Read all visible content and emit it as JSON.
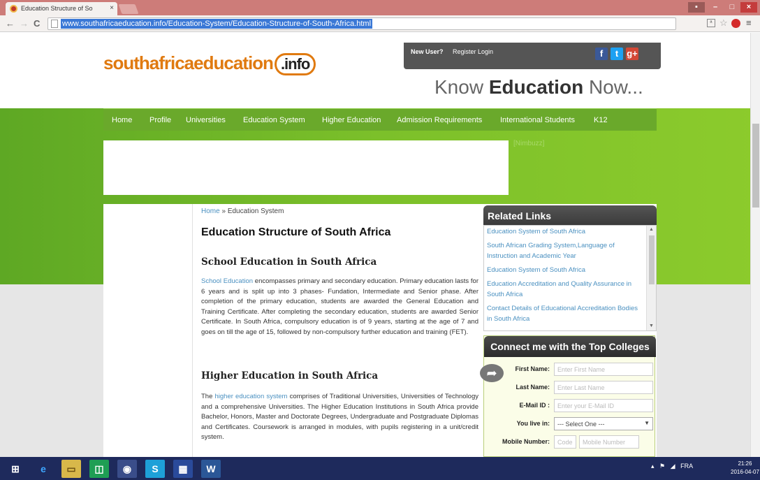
{
  "browser": {
    "tab_title": "Education Structure of So",
    "url": "www.southafricaeducation.info/Education-System/Education-Structure-of-South-Africa.html"
  },
  "header": {
    "logo_text": "southafricaeducation",
    "logo_badge": ".info",
    "new_user": "New User?",
    "register_login": "Register Login",
    "tagline_pre": "Know",
    "tagline_bold": "Education",
    "tagline_post": "Now..."
  },
  "nav": {
    "items": [
      "Home",
      "Profile",
      "Universities",
      "Education System",
      "Higher Education",
      "Admission Requirements",
      "International Students",
      "K12"
    ]
  },
  "ad_label": "[Nimbuzz]",
  "breadcrumb": {
    "home": "Home",
    "sep": "»",
    "current": "Education System"
  },
  "article": {
    "title": "Education Structure of South Africa",
    "sections": [
      {
        "heading": "School Education in South Africa",
        "link": "School Education",
        "text": " encompasses primary and secondary education. Primary education lasts for 6 years and is split up into 3 phases- Fundation, Intermediate and Senior phase. After completion of the primary education, students are awarded the General Education and Training Certificate. After completing the secondary education, students are awarded Senior Certificate. In South Africa, compulsory education is of 9 years, starting at the age of 7 and goes on till the age of 15, followed by non-compulsory further education and training (FET)."
      },
      {
        "heading": "Higher Education in South Africa",
        "pre": "The ",
        "link": "higher education system",
        "text": " comprises of Traditional Universities, Universities of Technology and a comprehensive Universities. The Higher Education Institutions in South Africa provide Bachelor, Honors, Master and Doctorate Degrees, Undergraduate and Postgraduate Diplomas and Certificates. Coursework is arranged in modules, with pupils registering in a unit/credit system."
      }
    ]
  },
  "related": {
    "title": "Related Links",
    "items": [
      "Education System of South Africa",
      "South African Grading System,Language of Instruction and Academic Year",
      "Education System of South Africa",
      "Education Accreditation and Quality Assurance in South Africa",
      "Contact Details of Educational Accreditation Bodies in South Africa"
    ]
  },
  "connect_form": {
    "title": "Connect me with the Top Colleges",
    "first_name_label": "First Name:",
    "first_name_placeholder": "Enter First Name",
    "last_name_label": "Last Name:",
    "last_name_placeholder": "Enter Last Name",
    "email_label": "E-Mail ID :",
    "email_placeholder": "Enter your E-Mail ID",
    "live_label": "You live in:",
    "live_value": "--- Select One ---",
    "mobile_label": "Mobile Number:",
    "code_placeholder": "Code",
    "mobile_placeholder": "Mobile Number"
  },
  "taskbar": {
    "language": "FRA",
    "time": "21:26",
    "date": "2016-04-07"
  },
  "colors": {
    "brand_orange": "#e07a10",
    "nav_green": "#6aa92b",
    "link_blue": "#4a90c0",
    "url_highlight": "#3a78d6"
  }
}
